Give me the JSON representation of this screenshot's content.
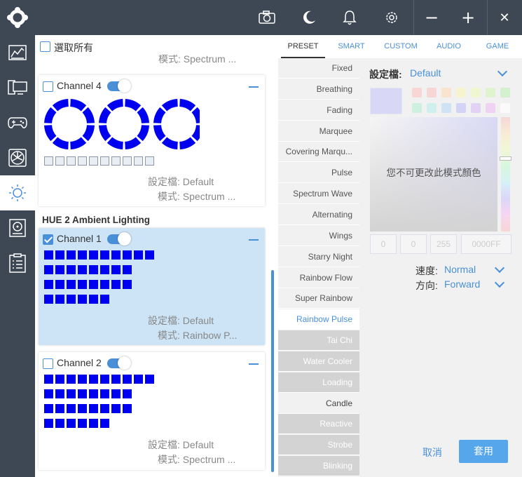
{
  "topbar": {
    "icons": [
      "camera-icon",
      "moon-icon",
      "bell-icon",
      "gear-icon"
    ],
    "window_controls": {
      "minimize": "−",
      "maximize": "+",
      "close": "✕"
    }
  },
  "sidebar": {
    "items": [
      "dashboard-icon",
      "pc-monitor-icon",
      "gamepad-icon",
      "fan-icon",
      "lighting-icon",
      "storage-icon",
      "checklist-icon"
    ],
    "active_index": 4
  },
  "left": {
    "select_all": "選取所有",
    "top_partial": {
      "mode_label": "模式:",
      "mode_value": "Spectrum ..."
    },
    "channel4": {
      "label": "Channel 4",
      "profile_label": "設定檔:",
      "profile_value": "Default",
      "mode_label": "模式:",
      "mode_value": "Spectrum ..."
    },
    "section_title": "HUE 2 Ambient Lighting",
    "channel1": {
      "label": "Channel 1",
      "profile_label": "設定檔:",
      "profile_value": "Default",
      "mode_label": "模式:",
      "mode_value": "Rainbow P..."
    },
    "channel2": {
      "label": "Channel 2",
      "profile_label": "設定檔:",
      "profile_value": "Default",
      "mode_label": "模式:",
      "mode_value": "Spectrum ..."
    },
    "led_color": "#0000f0"
  },
  "tabs": [
    "PRESET",
    "SMART",
    "CUSTOM",
    "AUDIO",
    "GAME"
  ],
  "active_tab": "PRESET",
  "effects": [
    {
      "name": "Fixed",
      "state": "normal"
    },
    {
      "name": "Breathing",
      "state": "normal"
    },
    {
      "name": "Fading",
      "state": "normal"
    },
    {
      "name": "Marquee",
      "state": "normal"
    },
    {
      "name": "Covering Marqu...",
      "state": "normal"
    },
    {
      "name": "Pulse",
      "state": "normal"
    },
    {
      "name": "Spectrum Wave",
      "state": "normal"
    },
    {
      "name": "Alternating",
      "state": "normal"
    },
    {
      "name": "Wings",
      "state": "normal"
    },
    {
      "name": "Starry Night",
      "state": "normal"
    },
    {
      "name": "Rainbow Flow",
      "state": "normal"
    },
    {
      "name": "Super Rainbow",
      "state": "normal"
    },
    {
      "name": "Rainbow Pulse",
      "state": "selected"
    },
    {
      "name": "Tai Chi",
      "state": "disabled"
    },
    {
      "name": "Water Cooler",
      "state": "disabled"
    },
    {
      "name": "Loading",
      "state": "disabled"
    },
    {
      "name": "Candle",
      "state": "white"
    },
    {
      "name": "Reactive",
      "state": "disabled"
    },
    {
      "name": "Strobe",
      "state": "disabled"
    },
    {
      "name": "Blinking",
      "state": "disabled"
    }
  ],
  "settings": {
    "profile_label": "設定檔:",
    "profile_value": "Default",
    "color_disabled_msg": "您不可更改此模式顏色",
    "rgb": [
      "0",
      "0",
      "255"
    ],
    "hex": "0000FF",
    "speed_label": "速度:",
    "speed_value": "Normal",
    "direction_label": "方向:",
    "direction_value": "Forward",
    "cancel": "取消",
    "apply": "套用"
  },
  "colors": {
    "accent": "#4a90d9",
    "dark": "#3e4854",
    "selected_card": "#cce4f6",
    "swatches": [
      "#f9d6d6",
      "#f9d6d6",
      "#f9e4cf",
      "#f7f3cf",
      "#eef7cf",
      "#dff3cf",
      "#d3f0cf",
      "#cff0df",
      "#cff0ef",
      "#cfe3f5",
      "#d3d3f5",
      "#e2d3f5",
      "#f0d3f3",
      "#fafafa"
    ]
  }
}
